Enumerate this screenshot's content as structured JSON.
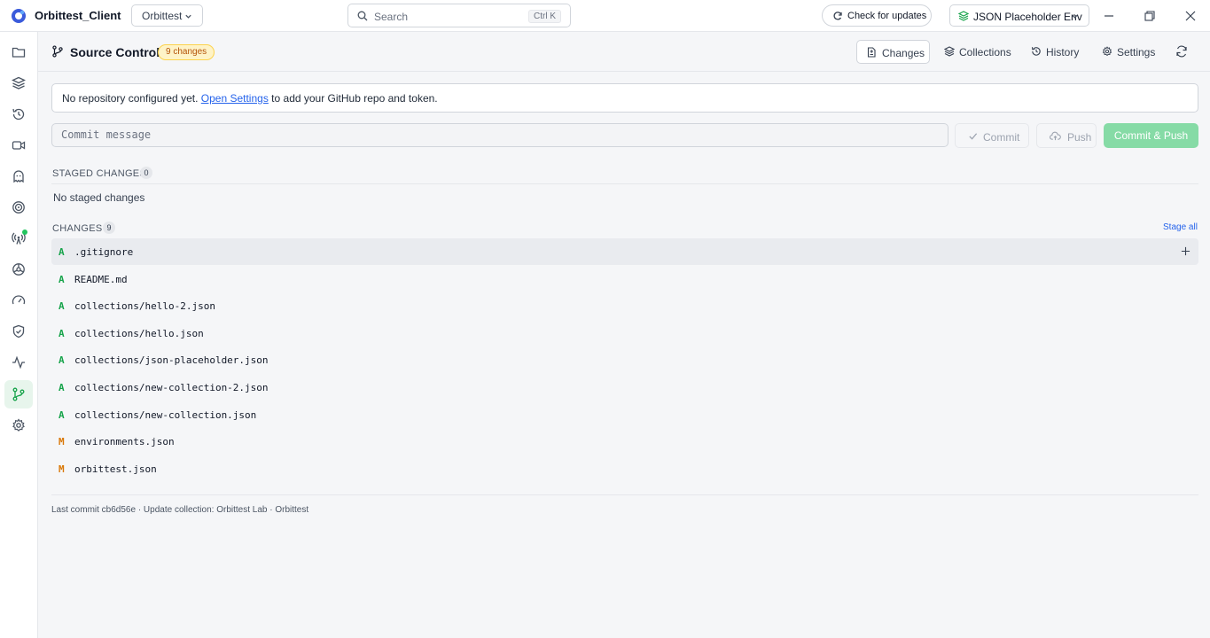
{
  "app": {
    "name": "Orbittest_Client",
    "workspace": "Orbittest",
    "search_placeholder": "Search",
    "search_shortcut": "Ctrl K",
    "update_label": "Check for updates",
    "environment": "JSON Placeholder Env"
  },
  "sidebar": {
    "items": [
      {
        "name": "folder-icon",
        "active": false
      },
      {
        "name": "layers-icon",
        "active": false
      },
      {
        "name": "history-icon",
        "active": false
      },
      {
        "name": "video-icon",
        "active": false
      },
      {
        "name": "ghost-icon",
        "active": false
      },
      {
        "name": "target-icon",
        "active": false
      },
      {
        "name": "broadcast-icon",
        "active": false,
        "badge": true
      },
      {
        "name": "webhook-icon",
        "active": false
      },
      {
        "name": "gauge-icon",
        "active": false
      },
      {
        "name": "shield-icon",
        "active": false
      },
      {
        "name": "activity-icon",
        "active": false
      },
      {
        "name": "git-branch-icon",
        "active": true
      },
      {
        "name": "settings-icon",
        "active": false
      }
    ]
  },
  "header": {
    "title": "Source Control",
    "changes_badge": "9 changes",
    "tabs": [
      {
        "label": "Changes",
        "active": true
      },
      {
        "label": "Collections",
        "active": false
      },
      {
        "label": "History",
        "active": false
      },
      {
        "label": "Settings",
        "active": false
      }
    ]
  },
  "notice": {
    "before": "No repository configured yet.",
    "link": "Open Settings",
    "after": "to add your GitHub repo and token."
  },
  "commit": {
    "placeholder": "Commit message",
    "commit_label": "Commit",
    "push_label": "Push",
    "commit_push_label": "Commit & Push"
  },
  "staged": {
    "title": "STAGED CHANGES",
    "count": "0",
    "empty_text": "No staged changes"
  },
  "changes": {
    "title": "CHANGES",
    "count": "9",
    "stage_all": "Stage all",
    "files": [
      {
        "status": "A",
        "path": ".gitignore"
      },
      {
        "status": "A",
        "path": "README.md"
      },
      {
        "status": "A",
        "path": "collections/hello-2.json"
      },
      {
        "status": "A",
        "path": "collections/hello.json"
      },
      {
        "status": "A",
        "path": "collections/json-placeholder.json"
      },
      {
        "status": "A",
        "path": "collections/new-collection-2.json"
      },
      {
        "status": "A",
        "path": "collections/new-collection.json"
      },
      {
        "status": "M",
        "path": "environments.json"
      },
      {
        "status": "M",
        "path": "orbittest.json"
      }
    ]
  },
  "footer": {
    "last_commit": "Last commit cb6d56e · Update collection: Orbittest Lab · Orbittest"
  },
  "colors": {
    "accent_green": "#22c55e",
    "added": "#16a34a",
    "modified": "#d97706",
    "link": "#2563eb"
  }
}
